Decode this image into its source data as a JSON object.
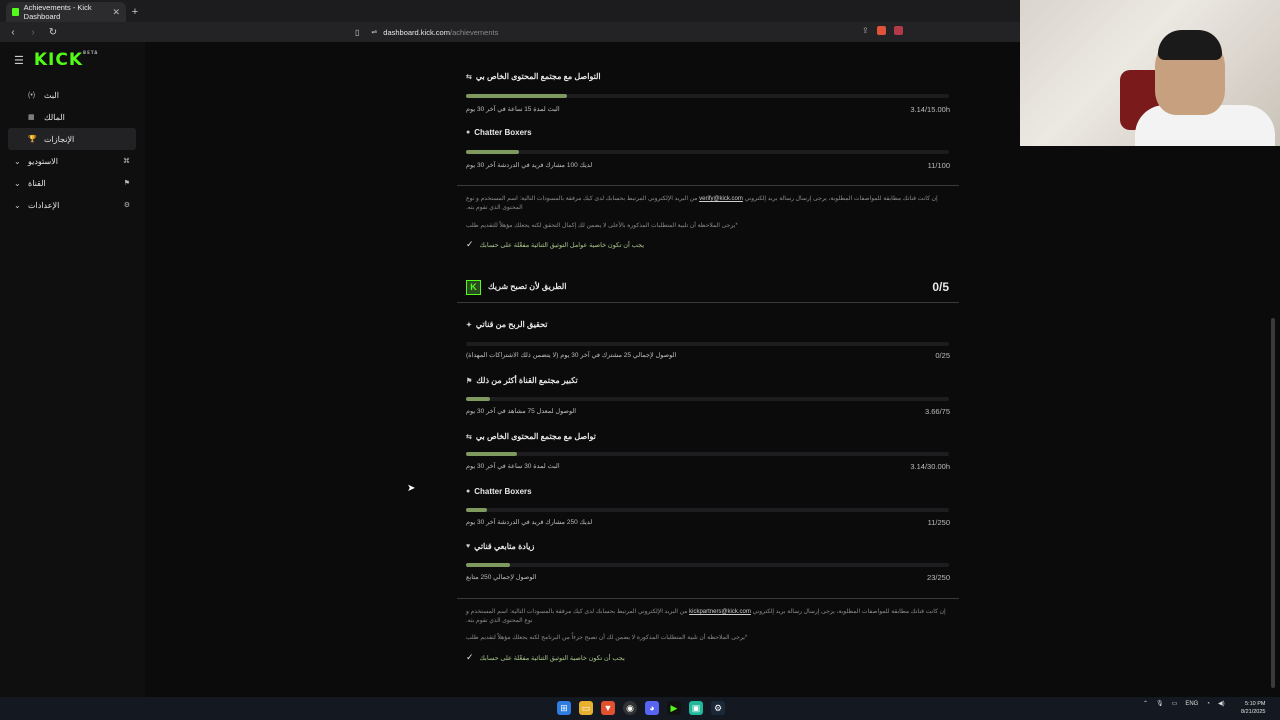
{
  "browser": {
    "tab_title": "Achievements - Kick Dashboard",
    "tab_close": "✕",
    "new_tab": "+",
    "url_host": "dashboard.kick.com",
    "url_path": "/achievements"
  },
  "sidebar": {
    "logo": "KICK",
    "beta": "BETA",
    "items": [
      {
        "label": "البث",
        "icon": "(•)"
      },
      {
        "label": "المالك",
        "icon": "▦"
      },
      {
        "label": "الإنجازات",
        "icon": "🏆"
      },
      {
        "label": "الاستوديو",
        "icon": "⌘"
      },
      {
        "label": "القناة",
        "icon": "⚑"
      },
      {
        "label": "الإعدادات",
        "icon": "⚙"
      }
    ]
  },
  "section1": {
    "items": [
      {
        "title": "التواصل مع مجتمع المحتوى الخاص بي",
        "requirement": "البث لمدة 15 ساعة في آخر 30 يوم",
        "value": "3.14/15.00h",
        "progress": 0.21
      },
      {
        "title": "Chatter Boxers",
        "requirement": "لديك 100 مشارك فريد في الدردشة آخر 30 يوم",
        "value": "11/100",
        "progress": 0.11
      }
    ],
    "note_prefix": "إن كانت قناتك مطابقة للمواصفات المطلوبة، يرجى إرسال رسالة بريد إلكتروني",
    "email": "verify@kick.com",
    "note_suffix": "من البريد الإلكتروني المرتبط بحسابك لدى كيك مرفقة بالمسودات التالية: اسم المستخدم و نوع المحتوى الذي تقوم بثه.",
    "note2": "*يرجى الملاحظة أن تلبية المتطلبات المذكورة بالأعلى لا يضمن لك إكمال التحقق لكنه يجعلك مؤهلاً للتقديم طلب",
    "check": "يجب أن تكون خاصية عوامل التوثيق الثنائية مفعّلة على حسابك"
  },
  "section2": {
    "title": "الطريق لأن تصبح شريك",
    "count": "0/5",
    "items": [
      {
        "title": "تحقيق الربح من قناتي",
        "requirement": "الوصول لإجمالي 25 مشترك في آخر 30 يوم (لا يتضمن ذلك الاشتراكات المهداة)",
        "value": "0/25",
        "progress": 0
      },
      {
        "title": "تكبير مجتمع القناة أكثر من ذلك",
        "requirement": "الوصول لمعدل 75 مشاهد في آخر 30 يوم",
        "value": "3.66/75",
        "progress": 0.05
      },
      {
        "title": "تواصل مع مجتمع المحتوى الخاص بي",
        "requirement": "البث لمدة 30 ساعة في آخر 30 يوم",
        "value": "3.14/30.00h",
        "progress": 0.105
      },
      {
        "title": "Chatter Boxers",
        "requirement": "لديك 250 مشارك فريد في الدردشة آخر 30 يوم",
        "value": "11/250",
        "progress": 0.044
      },
      {
        "title": "زيادة متابعي قناتي",
        "requirement": "الوصول لإجمالي 250 متابع",
        "value": "23/250",
        "progress": 0.092
      }
    ],
    "note_prefix": "إن كانت قناتك مطابقة للمواصفات المطلوبة، يرجى إرسال رسالة بريد إلكتروني",
    "email": "kickpartners@kick.com",
    "note_suffix": "من البريد الإلكتروني المرتبط بحسابك لدى كيك مرفقة بالمسودات التالية: اسم المستخدم و نوع المحتوى الذي تقوم بثه.",
    "note2": "*يرجى الملاحظة أن تلبية المتطلبات المذكورة لا يضمن لك أن تصبح جزءاً من البرنامج لكنه يجعلك مؤهلاً لتقديم طلب",
    "check": "يجب أن تكون خاصية التوثيق الثنائية مفعّلة على حسابك"
  },
  "taskbar": {
    "lang": "ENG",
    "time": "5:10 PM",
    "date": "8/21/2025"
  }
}
